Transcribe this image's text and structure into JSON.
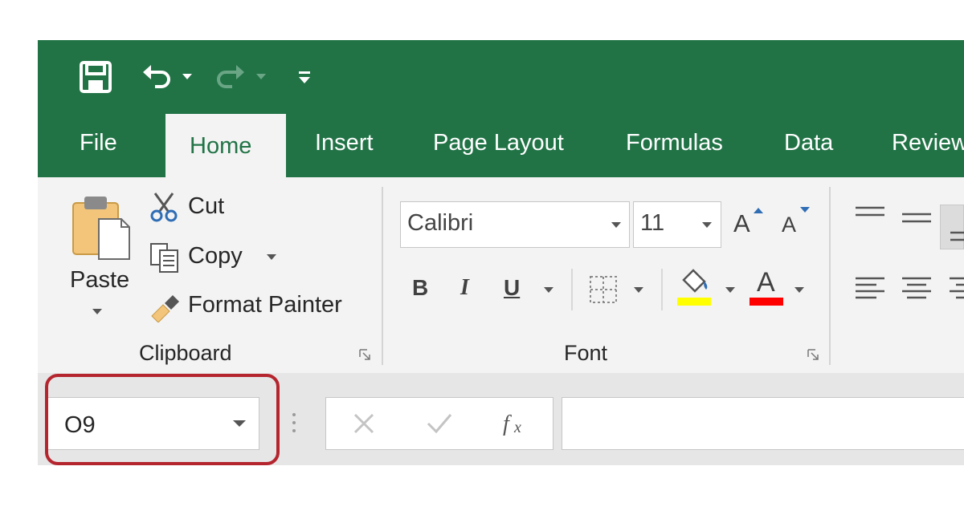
{
  "tabs": [
    "File",
    "Home",
    "Insert",
    "Page Layout",
    "Formulas",
    "Data",
    "Review"
  ],
  "clipboard": {
    "paste": "Paste",
    "cut": "Cut",
    "copy": "Copy",
    "format_painter": "Format Painter",
    "group_label": "Clipboard"
  },
  "font": {
    "family": "Calibri",
    "size": "11",
    "group_label": "Font",
    "bold": "B",
    "italic": "I",
    "underline": "U",
    "grow": "A",
    "shrink": "A",
    "font_color_glyph": "A",
    "fill_color": "#ffff00",
    "text_color": "#ff0000"
  },
  "formula_bar": {
    "name_box": "O9",
    "formula": ""
  },
  "colors": {
    "excel_green": "#217346",
    "highlight": "#b5252e"
  },
  "icons": [
    "save-icon",
    "undo-icon",
    "redo-icon",
    "customize-qat-icon",
    "paste-icon",
    "scissors-icon",
    "copy-icon",
    "paintbrush-icon",
    "bold-icon",
    "italic-icon",
    "underline-icon",
    "borders-icon",
    "fill-bucket-icon",
    "font-color-icon",
    "align-icon",
    "cancel-icon",
    "enter-icon",
    "fx-icon"
  ]
}
